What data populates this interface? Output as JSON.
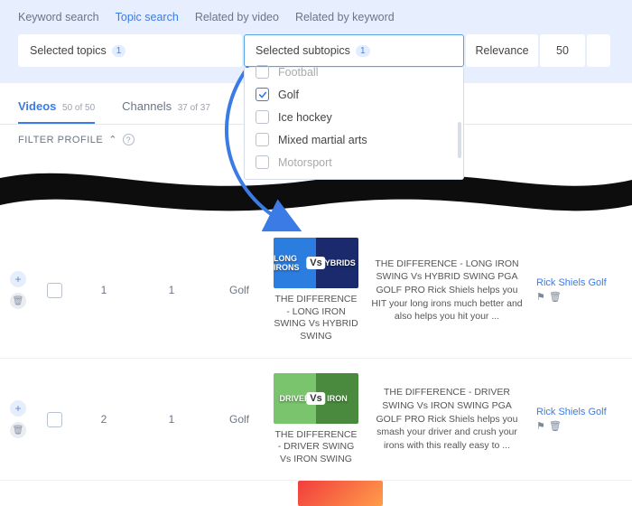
{
  "search_tabs": {
    "keyword": "Keyword search",
    "topic": "Topic search",
    "related_video": "Related by video",
    "related_keyword": "Related by keyword"
  },
  "filters": {
    "topics_label": "Selected topics",
    "topics_count": "1",
    "subtopics_label": "Selected subtopics",
    "subtopics_count": "1",
    "sort_label": "Relevance",
    "page_size": "50"
  },
  "subtopic_options": {
    "cut_top": "Football",
    "golf": "Golf",
    "hockey": "Ice hockey",
    "mma": "Mixed martial arts",
    "cut_bot": "Motorsport"
  },
  "main_tabs": {
    "videos": "Videos",
    "videos_count": "50 of 50",
    "channels": "Channels",
    "channels_count": "37 of 37"
  },
  "filter_profile": "FILTER PROFILE",
  "help": "?",
  "results": [
    {
      "col1": "1",
      "col2": "1",
      "topic": "Golf",
      "thumb_left": "LONG IRONS",
      "thumb_right": "HYBRIDS",
      "video_title": "THE DIFFERENCE - LONG IRON SWING Vs HYBRID SWING",
      "desc": "THE DIFFERENCE - LONG IRON SWING Vs HYBRID SWING PGA GOLF PRO Rick Shiels helps you HIT your long irons much better and also helps you hit your ...",
      "channel": "Rick Shiels Golf"
    },
    {
      "col1": "2",
      "col2": "1",
      "topic": "Golf",
      "thumb_left": "DRIVER",
      "thumb_right": "IRON",
      "video_title": "THE DIFFERENCE - DRIVER SWING Vs IRON SWING",
      "desc": "THE DIFFERENCE - DRIVER SWING Vs IRON SWING PGA GOLF PRO Rick Shiels helps you smash your driver and crush your irons with this really easy to ...",
      "channel": "Rick Shiels Golf"
    }
  ]
}
